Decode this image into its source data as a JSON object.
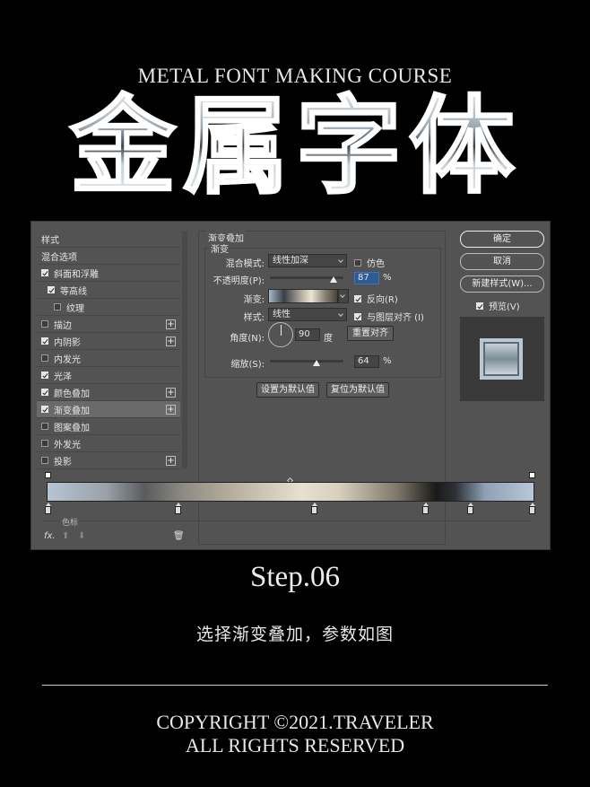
{
  "header": {
    "course_title": "METAL FONT MAKING COURSE",
    "hero_text": "金属字体"
  },
  "panel": {
    "styles": [
      {
        "label": "样式",
        "checkbox": null,
        "plus": false
      },
      {
        "label": "混合选项",
        "checkbox": null,
        "plus": false
      },
      {
        "label": "斜面和浮雕",
        "checkbox": true,
        "plus": false
      },
      {
        "label": "等高线",
        "checkbox": true,
        "plus": false
      },
      {
        "label": "纹理",
        "checkbox": false,
        "plus": false
      },
      {
        "label": "描边",
        "checkbox": false,
        "plus": true
      },
      {
        "label": "内阴影",
        "checkbox": true,
        "plus": true
      },
      {
        "label": "内发光",
        "checkbox": false,
        "plus": false
      },
      {
        "label": "光泽",
        "checkbox": true,
        "plus": false
      },
      {
        "label": "颜色叠加",
        "checkbox": true,
        "plus": true
      },
      {
        "label": "渐变叠加",
        "checkbox": true,
        "plus": true,
        "selected": true
      },
      {
        "label": "图案叠加",
        "checkbox": false,
        "plus": false
      },
      {
        "label": "外发光",
        "checkbox": false,
        "plus": false
      },
      {
        "label": "投影",
        "checkbox": false,
        "plus": true
      }
    ],
    "fx_label": "fx.",
    "group_title": "渐变叠加",
    "inner_title": "渐变",
    "blend_mode_label": "混合模式:",
    "blend_mode_value": "线性加深",
    "dither_label": "仿色",
    "opacity_label": "不透明度(P):",
    "opacity_value": "87",
    "opacity_unit": "%",
    "opacity_fraction": 0.87,
    "gradient_label": "渐变:",
    "reverse_label": "反向(R)",
    "style_label": "样式:",
    "style_value": "线性",
    "align_label": "与图层对齐 (I)",
    "angle_label": "角度(N):",
    "angle_value": "90",
    "angle_unit": "度",
    "reset_align_label": "重置对齐",
    "scale_label": "缩放(S):",
    "scale_value": "64",
    "scale_unit": "%",
    "scale_fraction": 0.64,
    "set_default_label": "设置为默认值",
    "reset_default_label": "复位为默认值",
    "ok_label": "确定",
    "cancel_label": "取消",
    "new_style_label": "新建样式(W)...",
    "preview_label": "预览(V)",
    "tab_partial": "色标"
  },
  "footer": {
    "step": "Step.06",
    "description": "选择渐变叠加，参数如图",
    "copyright_line1": "COPYRIGHT ©2021.TRAVELER",
    "copyright_line2": "ALL RIGHTS RESERVED"
  }
}
